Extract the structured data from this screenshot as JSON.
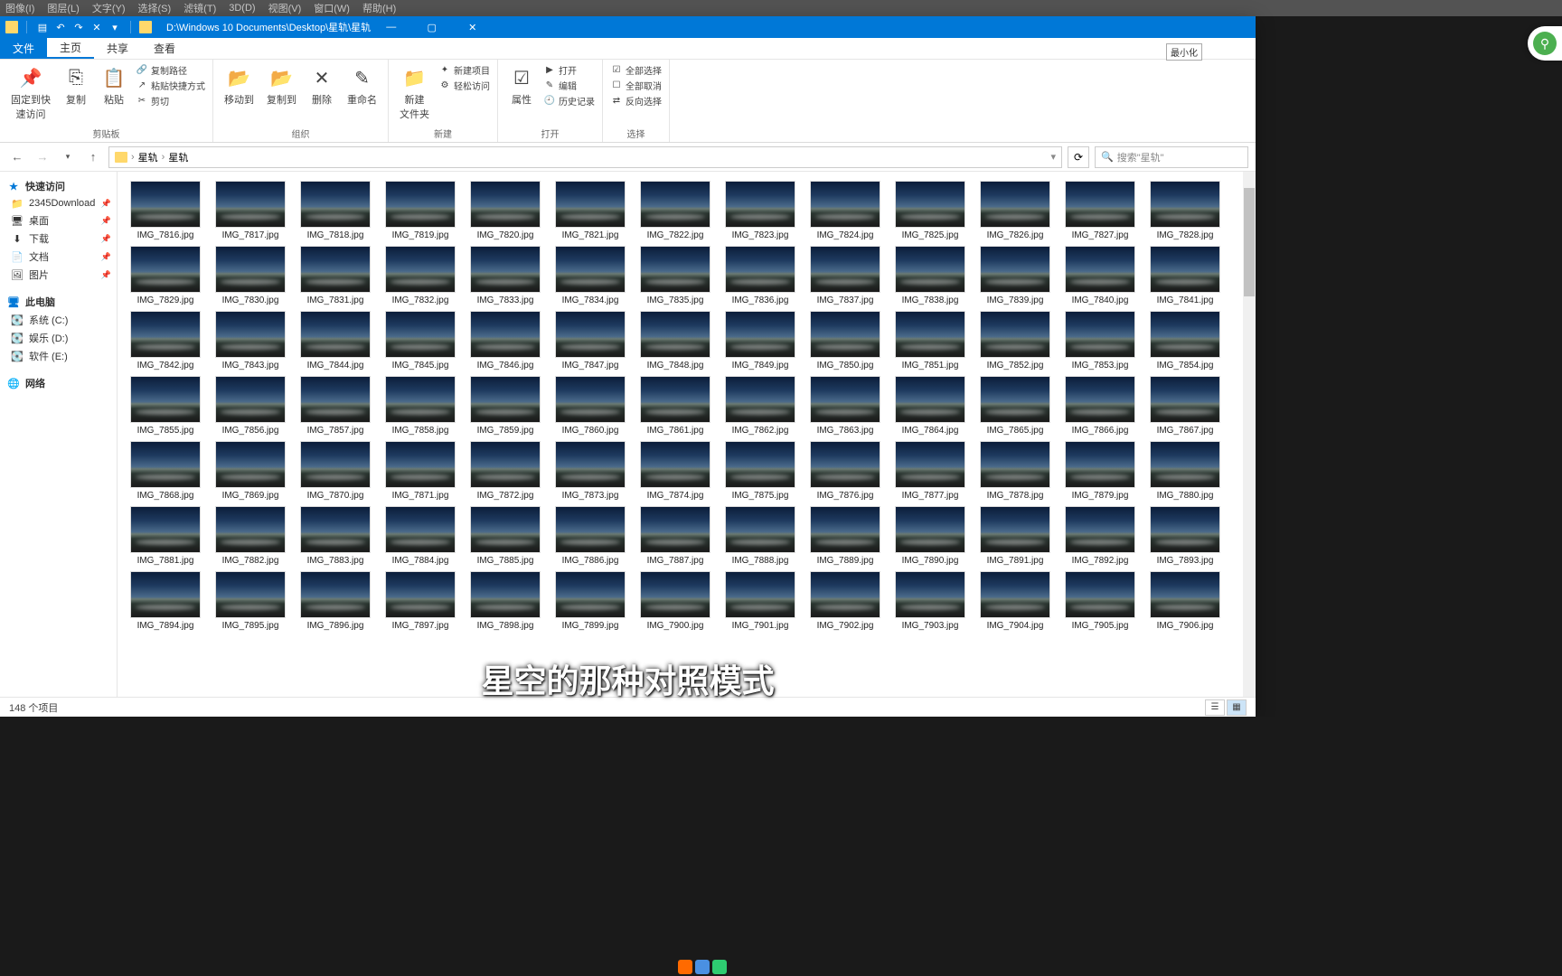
{
  "ps_menu": [
    "图像(I)",
    "图层(L)",
    "文字(Y)",
    "选择(S)",
    "滤镜(T)",
    "3D(D)",
    "视图(V)",
    "窗口(W)",
    "帮助(H)"
  ],
  "titlebar": {
    "path": "D:\\Windows 10 Documents\\Desktop\\星轨\\星轨",
    "min_tooltip": "最小化"
  },
  "ribbon_tabs": {
    "file": "文件",
    "home": "主页",
    "share": "共享",
    "view": "查看"
  },
  "ribbon": {
    "group_clipboard": {
      "label": "剪贴板",
      "pin": "固定到快\n速访问",
      "copy": "复制",
      "paste": "粘贴",
      "copy_path": "复制路径",
      "paste_shortcut": "粘贴快捷方式",
      "cut": "剪切"
    },
    "group_organize": {
      "label": "组织",
      "moveto": "移动到",
      "copyto": "复制到",
      "delete": "删除",
      "rename": "重命名"
    },
    "group_new": {
      "label": "新建",
      "newfolder": "新建\n文件夹",
      "newitem": "新建项目",
      "easy": "轻松访问"
    },
    "group_open": {
      "label": "打开",
      "properties": "属性",
      "open": "打开",
      "edit": "编辑",
      "history": "历史记录"
    },
    "group_select": {
      "label": "选择",
      "all": "全部选择",
      "none": "全部取消",
      "invert": "反向选择"
    }
  },
  "address": {
    "crumb1": "星轨",
    "crumb2": "星轨"
  },
  "search": {
    "placeholder": "搜索\"星轨\""
  },
  "sidebar": {
    "quick": "快速访问",
    "items": [
      {
        "icon": "📁",
        "label": "2345Download"
      },
      {
        "icon": "🖥",
        "label": "桌面"
      },
      {
        "icon": "⬇",
        "label": "下载"
      },
      {
        "icon": "📄",
        "label": "文档"
      },
      {
        "icon": "🖼",
        "label": "图片"
      }
    ],
    "thispc": "此电脑",
    "drives": [
      {
        "icon": "💽",
        "label": "系统 (C:)"
      },
      {
        "icon": "💽",
        "label": "娱乐 (D:)"
      },
      {
        "icon": "💽",
        "label": "软件 (E:)"
      }
    ],
    "network": "网络"
  },
  "files_start": 7816,
  "files_count": 91,
  "files_prefix": "IMG_",
  "files_ext": ".jpg",
  "status": {
    "count": "148 个项目"
  },
  "subtitle": "星空的那种对照模式"
}
